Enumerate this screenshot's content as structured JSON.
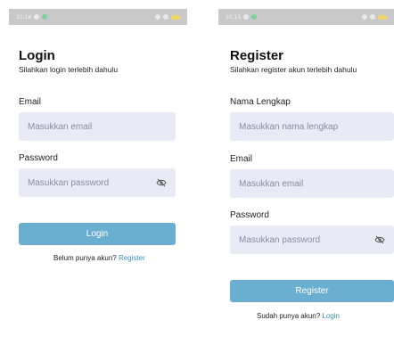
{
  "login_screen": {
    "status_time": "10.14",
    "title": "Login",
    "subtitle": "Silahkan login terlebih dahulu",
    "email_label": "Email",
    "email_placeholder": "Masukkan email",
    "password_label": "Password",
    "password_placeholder": "Masukkan password",
    "button_label": "Login",
    "footer_text": "Belum punya akun?",
    "footer_link": "Register"
  },
  "register_screen": {
    "status_time": "10.15",
    "title": "Register",
    "subtitle": "Silahkan register akun terlebih dahulu",
    "name_label": "Nama Lengkap",
    "name_placeholder": "Masukkan nama lengkap",
    "email_label": "Email",
    "email_placeholder": "Masukkan email",
    "password_label": "Password",
    "password_placeholder": "Masukkan password",
    "button_label": "Register",
    "footer_text": "Sudah punya akun?",
    "footer_link": "Login"
  },
  "colors": {
    "button": "#6aaed0",
    "input_background": "#e8eaf6",
    "link": "#3f8fbf",
    "status_bar": "#c9c9c9"
  },
  "icons": {
    "password_toggle": "eye-off-icon"
  }
}
